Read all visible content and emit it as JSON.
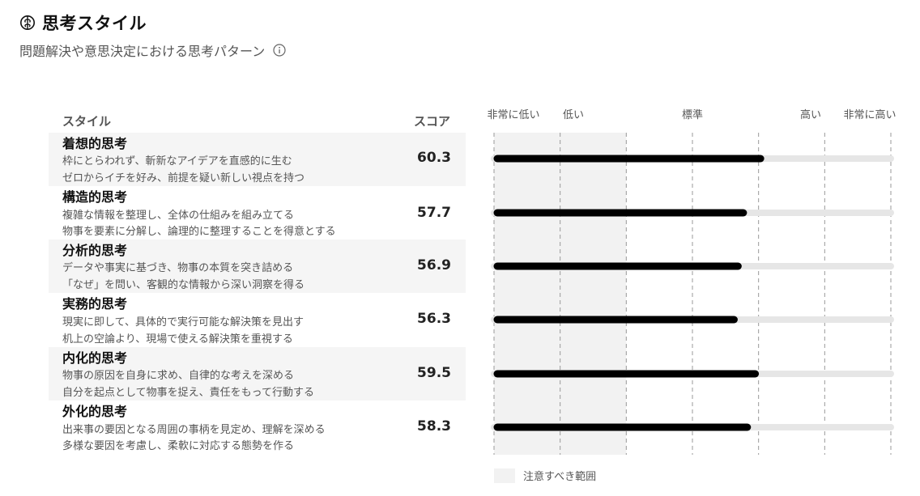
{
  "header": {
    "title": "思考スタイル",
    "subtitle": "問題解決や意思決定における思考パターン"
  },
  "table": {
    "style_header": "スタイル",
    "score_header": "スコア"
  },
  "legend": {
    "caution_label": "注意すべき範囲"
  },
  "colors": {
    "bar": "#000000",
    "track": "#e6e6e6",
    "caution": "#f2f2f2",
    "grid": "#999999"
  },
  "chart_data": {
    "type": "bar",
    "orientation": "horizontal",
    "scale_labels": [
      "非常に低い",
      "低い",
      "標準",
      "高い",
      "非常に高い"
    ],
    "caution_zone_label": "注意すべき範囲",
    "xlim": [
      20,
      80
    ],
    "categories": [
      "着想的思考",
      "構造的思考",
      "分析的思考",
      "実務的思考",
      "内化的思考",
      "外化的思考"
    ],
    "values": [
      60.3,
      57.7,
      56.9,
      56.3,
      59.5,
      58.3
    ],
    "rows": [
      {
        "name": "着想的思考",
        "desc1": "枠にとらわれず、斬新なアイデアを直感的に生む",
        "desc2": "ゼロからイチを好み、前提を疑い新しい視点を持つ",
        "score": "60.3"
      },
      {
        "name": "構造的思考",
        "desc1": "複雑な情報を整理し、全体の仕組みを組み立てる",
        "desc2": "物事を要素に分解し、論理的に整理することを得意とする",
        "score": "57.7"
      },
      {
        "name": "分析的思考",
        "desc1": "データや事実に基づき、物事の本質を突き詰める",
        "desc2": "「なぜ」を問い、客観的な情報から深い洞察を得る",
        "score": "56.9"
      },
      {
        "name": "実務的思考",
        "desc1": "現実に即して、具体的で実行可能な解決策を見出す",
        "desc2": "机上の空論より、現場で使える解決策を重視する",
        "score": "56.3"
      },
      {
        "name": "内化的思考",
        "desc1": "物事の原因を自身に求め、自律的な考えを深める",
        "desc2": "自分を起点として物事を捉え、責任をもって行動する",
        "score": "59.5"
      },
      {
        "name": "外化的思考",
        "desc1": "出来事の要因となる周囲の事柄を見定め、理解を深める",
        "desc2": "多様な要因を考慮し、柔軟に対応する態勢を作る",
        "score": "58.3"
      }
    ]
  }
}
